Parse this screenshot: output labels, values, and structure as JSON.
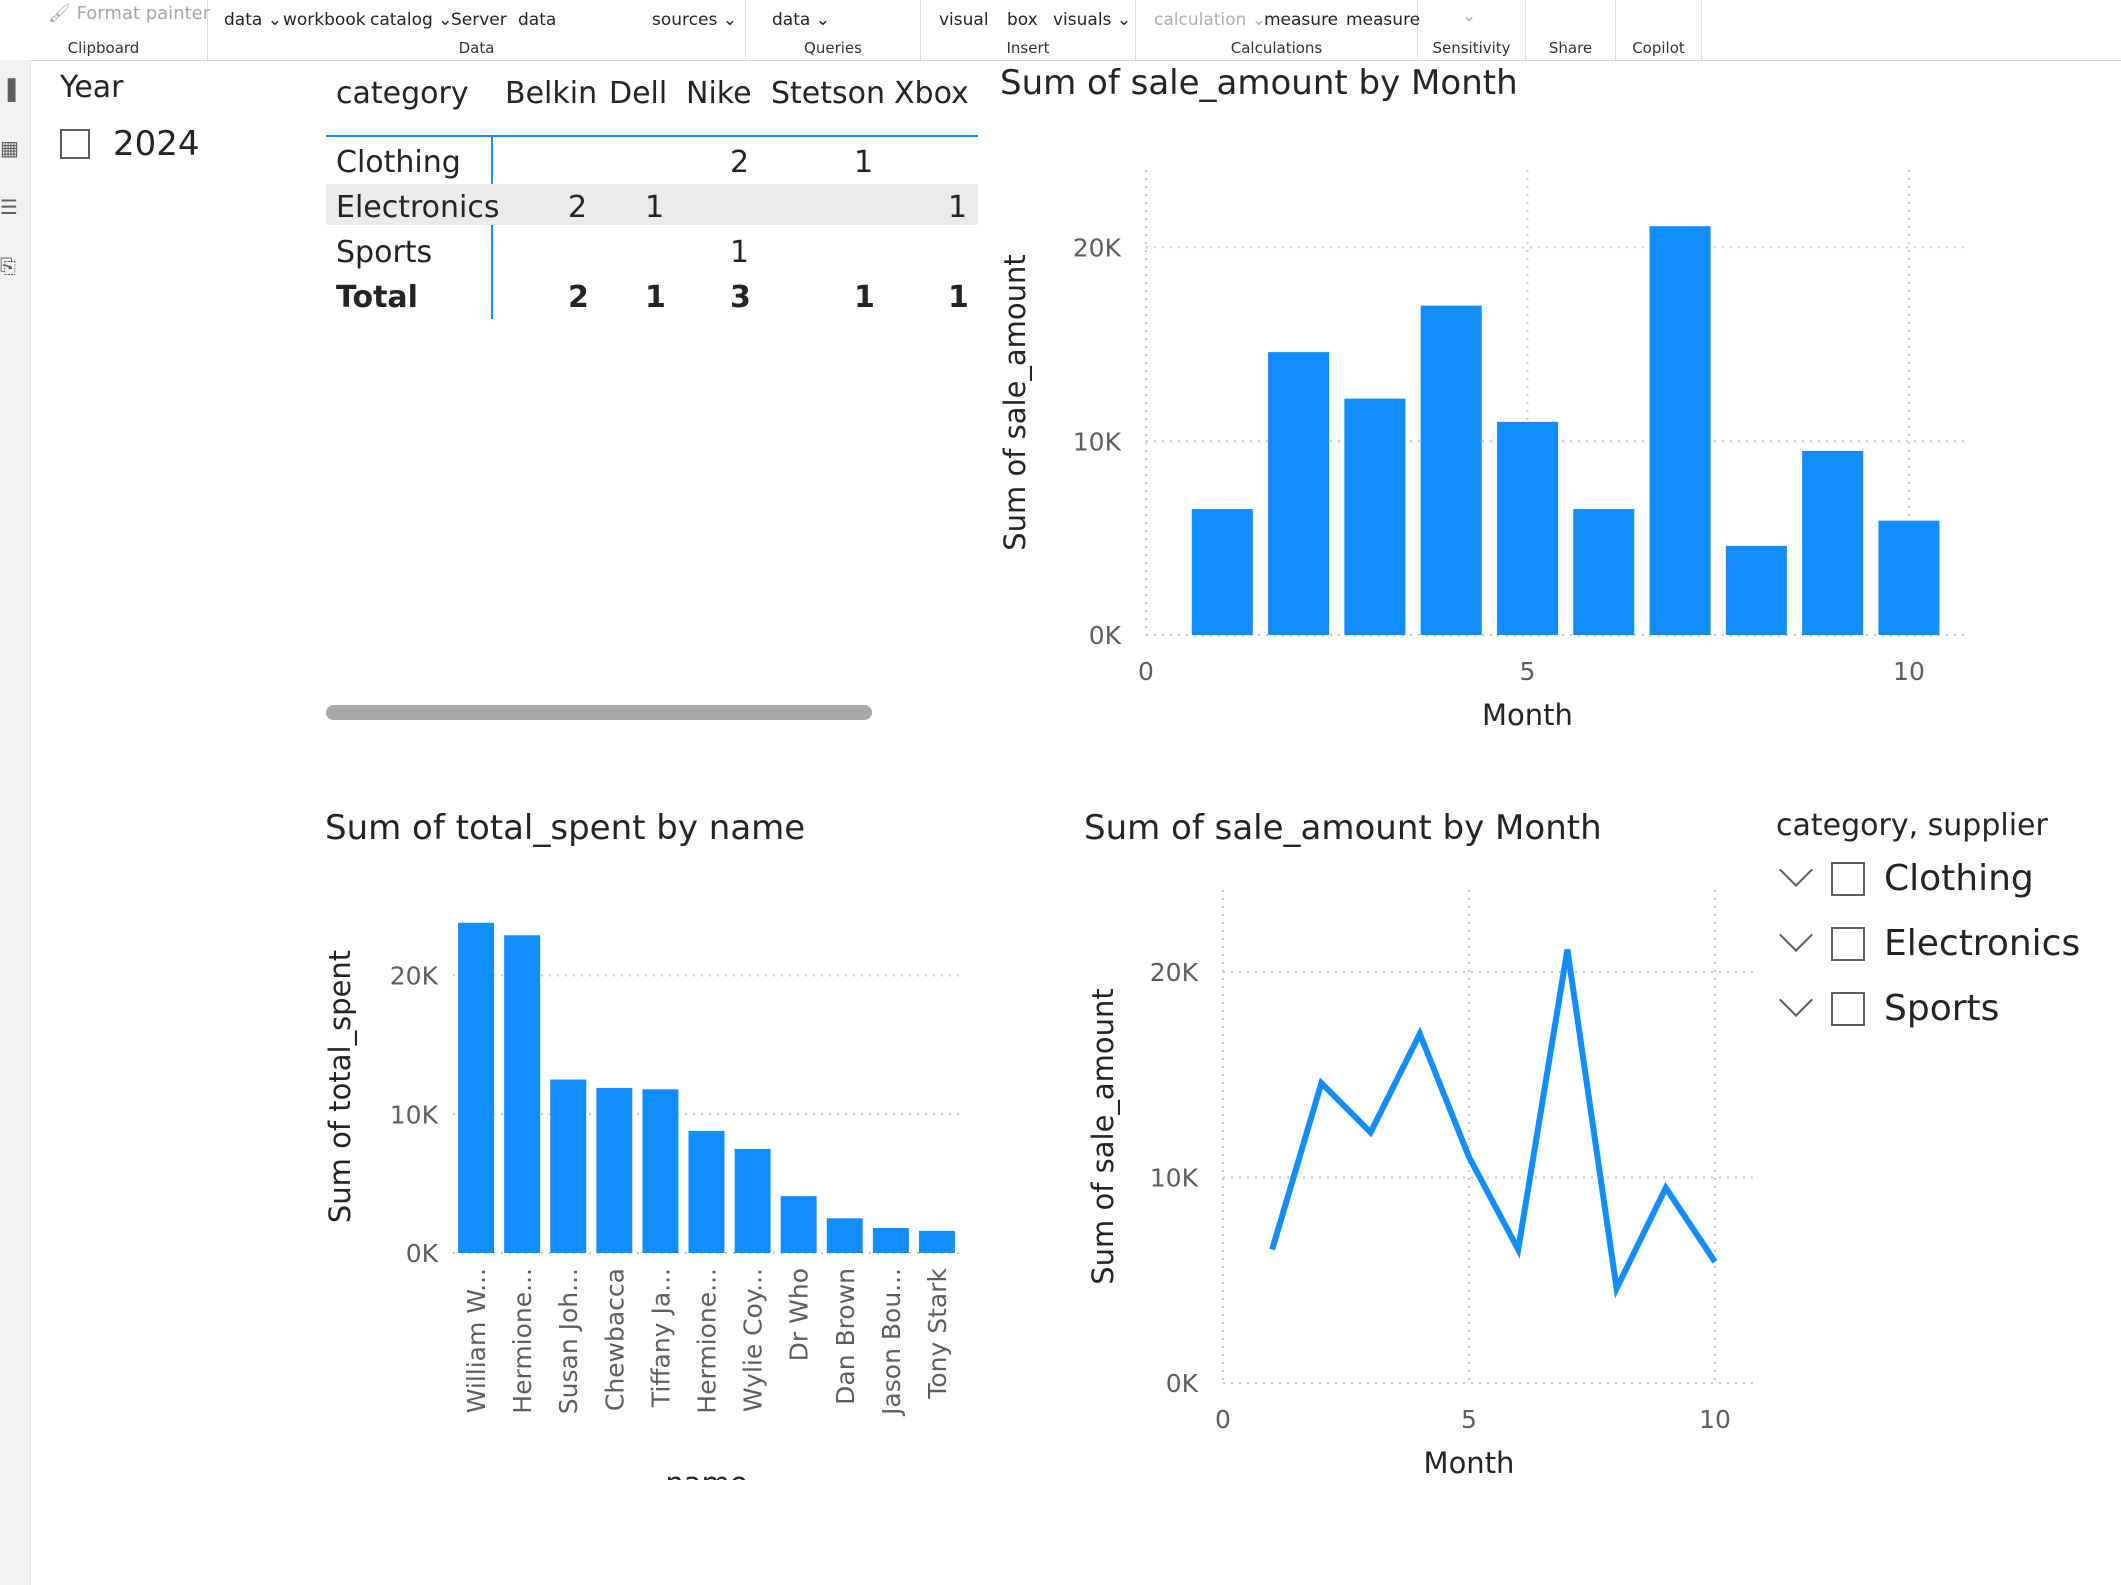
{
  "ribbon": {
    "format_painter": "Format painter",
    "groups": [
      {
        "name": "Clipboard"
      },
      {
        "name": "Data"
      },
      {
        "name": "Queries"
      },
      {
        "name": "Insert"
      },
      {
        "name": "Calculations"
      },
      {
        "name": "Sensitivity"
      },
      {
        "name": "Share"
      },
      {
        "name": "Copilot"
      }
    ],
    "buttons": {
      "get_data": "data",
      "excel_workbook": "workbook",
      "data_catalog": "catalog",
      "sql_server": "Server",
      "enter_data": "data",
      "recent_sources": "sources",
      "transform_data": "data",
      "new_visual": "visual",
      "text_box": "box",
      "more_visuals": "visuals",
      "new_visual_calc": "calculation",
      "new_measure": "measure",
      "quick_measure": "measure"
    }
  },
  "year_slicer": {
    "title": "Year",
    "items": [
      "2024"
    ]
  },
  "matrix": {
    "header_label": "category",
    "columns": [
      "Belkin",
      "Dell",
      "Nike",
      "Stetson",
      "Xbox"
    ],
    "rows": [
      {
        "label": "Clothing",
        "values": [
          "",
          "",
          "2",
          "1",
          ""
        ]
      },
      {
        "label": "Electronics",
        "values": [
          "2",
          "1",
          "",
          "",
          "1"
        ]
      },
      {
        "label": "Sports",
        "values": [
          "",
          "",
          "1",
          "",
          ""
        ]
      }
    ],
    "total": {
      "label": "Total",
      "values": [
        "2",
        "1",
        "3",
        "1",
        "1"
      ]
    }
  },
  "charts": {
    "bar_month": {
      "title": "Sum of sale_amount by Month"
    },
    "bar_name": {
      "title": "Sum of total_spent by name"
    },
    "line_month": {
      "title": "Sum of sale_amount by Month"
    }
  },
  "legend_slicer": {
    "title": "category, supplier",
    "items": [
      "Clothing",
      "Electronics",
      "Sports"
    ]
  },
  "colors": {
    "accent": "#118DFF",
    "grid": "#c8c8c8",
    "text": "#252423"
  },
  "chart_data": [
    {
      "type": "bar",
      "title": "Sum of sale_amount by Month",
      "xlabel": "Month",
      "ylabel": "Sum of sale_amount",
      "x": [
        1,
        2,
        3,
        4,
        5,
        6,
        7,
        8,
        9,
        10
      ],
      "values": [
        6500,
        14600,
        12200,
        17000,
        11000,
        6500,
        21100,
        4600,
        9500,
        5900
      ],
      "xlim": [
        0,
        10.8
      ],
      "ylim": [
        0,
        24000
      ],
      "xticks": [
        "0",
        "5",
        "10"
      ],
      "yticks": [
        "0K",
        "10K",
        "20K"
      ]
    },
    {
      "type": "bar",
      "title": "Sum of total_spent by name",
      "xlabel": "name",
      "ylabel": "Sum of total_spent",
      "categories": [
        "William W...",
        "Hermione...",
        "Susan Joh...",
        "Chewbacca",
        "Tiffany Ja...",
        "Hermione...",
        "Wylie Coy...",
        "Dr Who",
        "Dan Brown",
        "Jason Bou...",
        "Tony Stark"
      ],
      "values": [
        23800,
        22900,
        12500,
        11900,
        11800,
        8800,
        7500,
        4100,
        2500,
        1800,
        1600
      ],
      "ylim": [
        0,
        24000
      ],
      "yticks": [
        "0K",
        "10K",
        "20K"
      ]
    },
    {
      "type": "line",
      "title": "Sum of sale_amount by Month",
      "xlabel": "Month",
      "ylabel": "Sum of sale_amount",
      "x": [
        1,
        2,
        3,
        4,
        5,
        6,
        7,
        8,
        9,
        10
      ],
      "values": [
        6500,
        14600,
        12200,
        17000,
        11000,
        6500,
        21100,
        4600,
        9500,
        5900
      ],
      "xlim": [
        0,
        10
      ],
      "ylim": [
        0,
        24000
      ],
      "xticks": [
        "0",
        "5",
        "10"
      ],
      "yticks": [
        "0K",
        "10K",
        "20K"
      ]
    }
  ]
}
